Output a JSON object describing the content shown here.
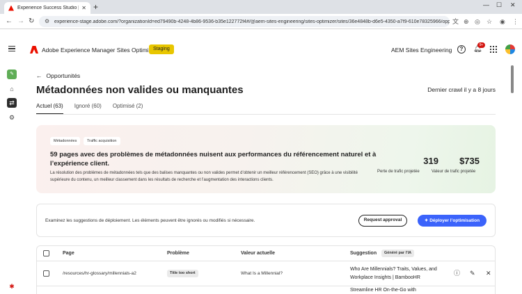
{
  "browser": {
    "tab_title": "Experience Success Studio | Ado",
    "tab_close": "✕",
    "new_tab": "+",
    "url": "experience-stage.adobe.com/?organizationId=ed79490b-4248-4b86-9536-b35e122772f4#/@aem-sites-engineering/sites-optimizer/sites/36e4848b-d6e5-4350-a7f9-610e78325966/opportunities/...",
    "window_controls": [
      "—",
      "☐",
      "✕"
    ]
  },
  "header": {
    "app_title": "Adobe Experience Manager Sites Optimizer",
    "env_badge": "Staging",
    "org_name": "AEM Sites Engineering",
    "notif_count": "9+"
  },
  "page": {
    "back_label": "Opportunités",
    "title": "Métadonnées non valides ou manquantes",
    "last_crawl": "Dernier crawl il y a 8 jours",
    "tabs": [
      {
        "label": "Actuel (63)",
        "active": true
      },
      {
        "label": "Ignoré (60)",
        "active": false
      },
      {
        "label": "Optimisé (2)",
        "active": false
      }
    ]
  },
  "hero": {
    "tags": [
      "Métadonnées",
      "Traffic acquisition"
    ],
    "title": "59 pages avec des problèmes de métadonnées nuisent aux performances du référencement naturel et à l’expérience client.",
    "description": "La résolution des problèmes de métadonnées tels que des balises manquantes ou non valides permet d’obtenir un meilleur référencement (SEO) grâce à une visibilité supérieure du contenu, un meilleur classement dans les résultats de recherche et l’augmentation des interactions clients.",
    "metrics": [
      {
        "value": "319",
        "label": "Perte de trafic projetée"
      },
      {
        "value": "$735",
        "label": "Valeur de trafic projetée"
      }
    ]
  },
  "deploy": {
    "text": "Examinez les suggestions de déploiement. Les éléments peuvent être ignorés ou modifiés si nécessaire.",
    "approval_label": "Request approval",
    "deploy_label": "Déployer l’optimisation"
  },
  "table": {
    "columns": {
      "page": "Page",
      "issue": "Problème",
      "current": "Valeur actuelle",
      "suggestion": "Suggestion",
      "ai_tag": "Généré par l’IA"
    },
    "rows": [
      {
        "page": "/resources/hr-glossary/millennials-a2",
        "issue": "Title too short",
        "current": "What Is a Millennial?",
        "suggestion": "Who Are Millennials? Traits, Values, and Workplace Insights | BambooHR"
      },
      {
        "suggestion": "Streamline HR On-the-Go with"
      }
    ]
  }
}
